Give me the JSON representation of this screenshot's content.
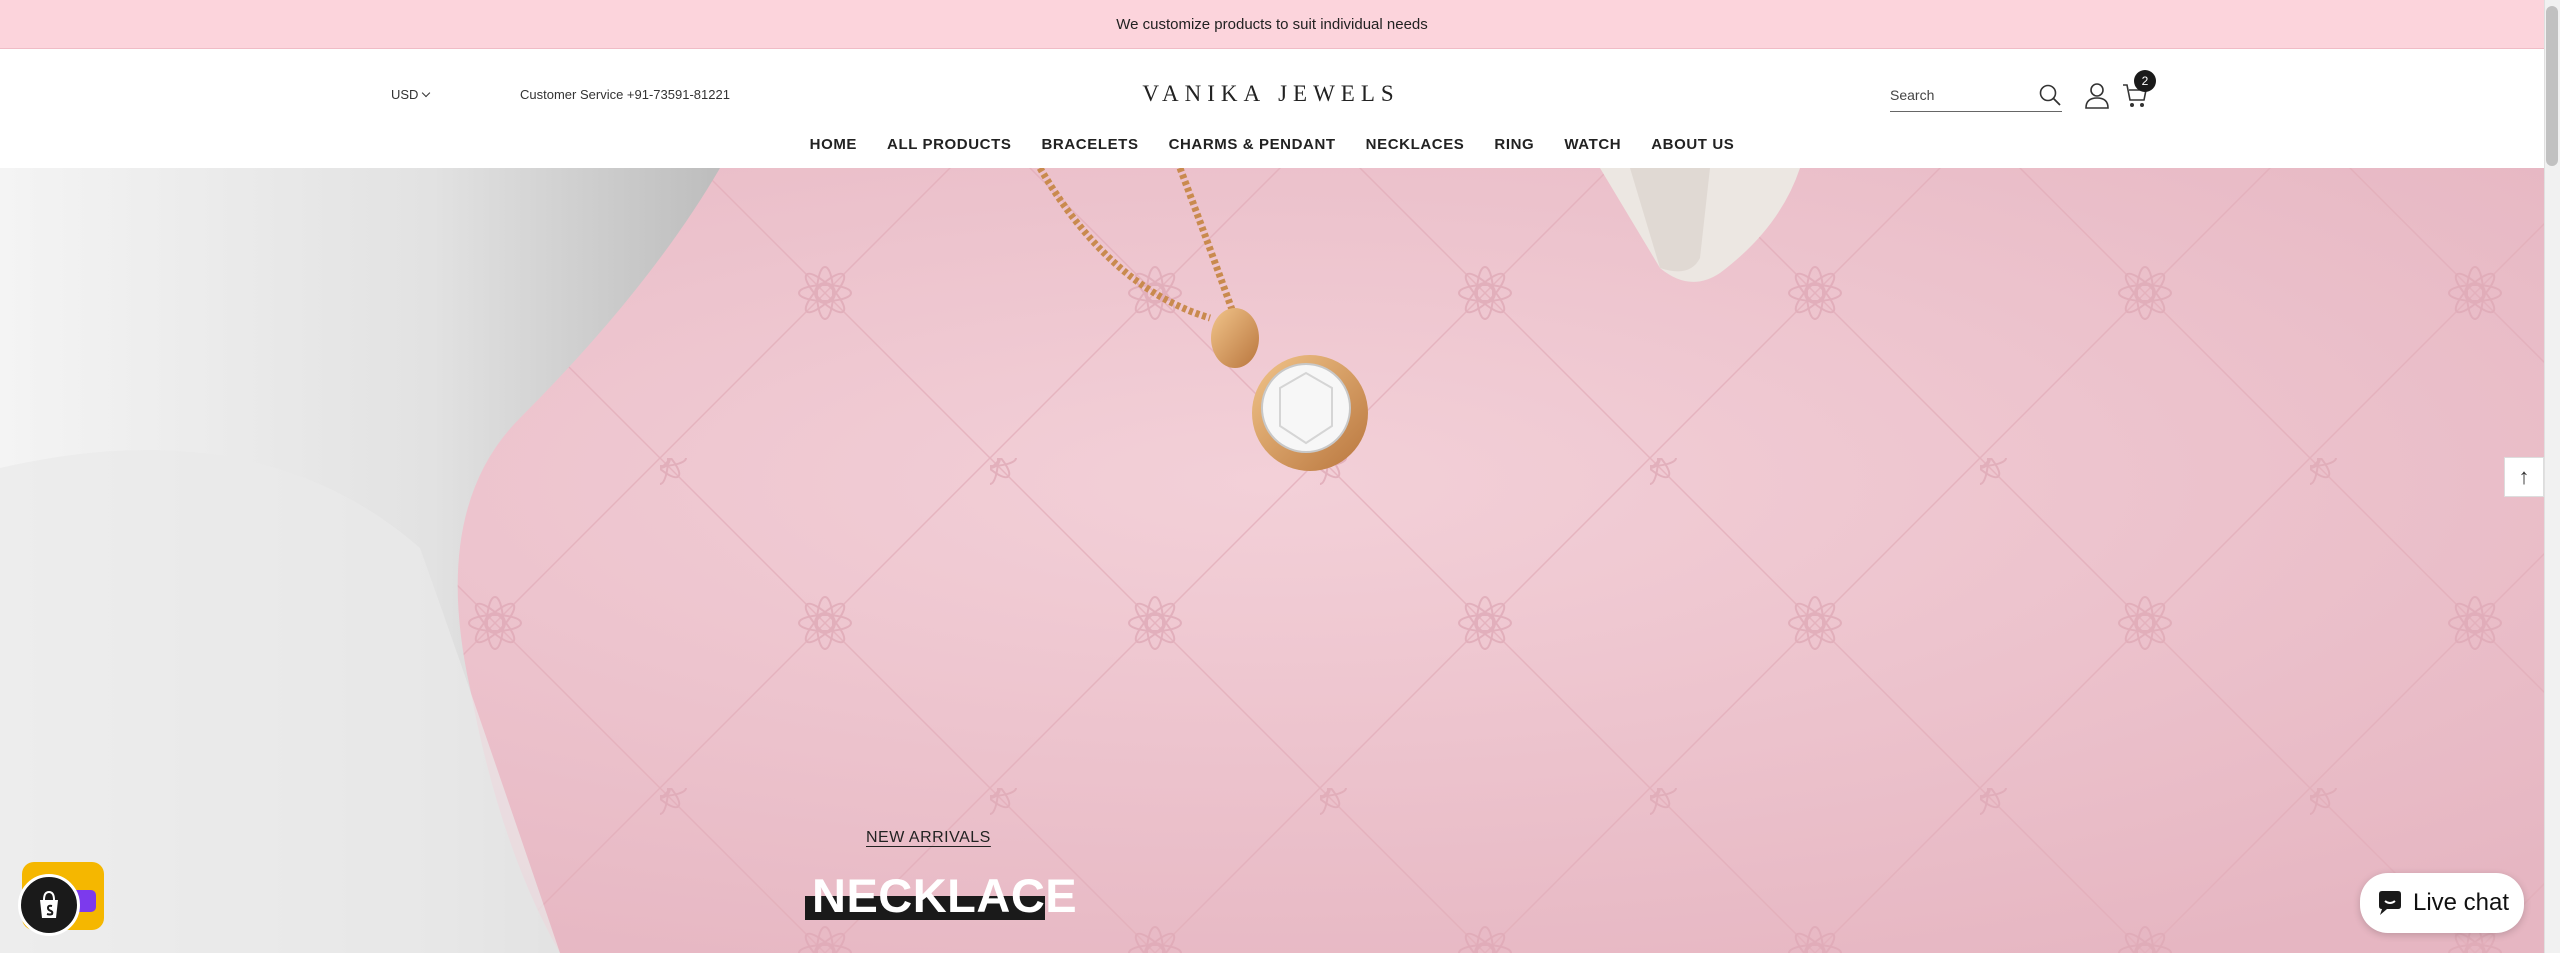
{
  "announcement": "We customize products to suit individual needs",
  "header": {
    "currency": "USD",
    "customer_service": "Customer Service +91-73591-81221",
    "logo_left": "VANIKA",
    "logo_right": "JEWELS",
    "search_placeholder": "Search",
    "cart_count": "2"
  },
  "nav": [
    "HOME",
    "ALL PRODUCTS",
    "BRACELETS",
    "CHARMS & PENDANT",
    "NECKLACES",
    "RING",
    "WATCH",
    "ABOUT US"
  ],
  "hero": {
    "subtitle": "NEW ARRIVALS",
    "title": "NECKLACE"
  },
  "widgets": {
    "live_chat": "Live chat",
    "back_to_top": "↑"
  },
  "colors": {
    "announcement_bg": "#fcd4dc",
    "hero_bg": "#eec6cf",
    "dark": "#1a1a1a"
  }
}
